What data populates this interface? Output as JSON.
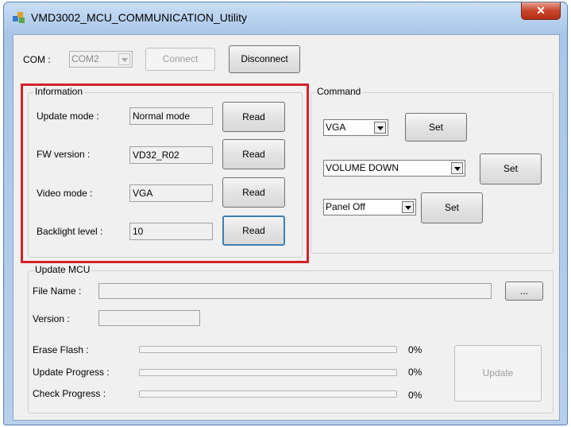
{
  "window": {
    "title": "VMD3002_MCU_COMMUNICATION_Utility",
    "close_glyph": "✕"
  },
  "com": {
    "label": "COM :",
    "port_value": "COM2",
    "connect_label": "Connect",
    "disconnect_label": "Disconnect"
  },
  "information": {
    "title": "Information",
    "rows": [
      {
        "label": "Update mode :",
        "value": "Normal mode",
        "button": "Read"
      },
      {
        "label": "FW version :",
        "value": "VD32_R02",
        "button": "Read"
      },
      {
        "label": "Video mode :",
        "value": "VGA",
        "button": "Read"
      },
      {
        "label": "Backlight level :",
        "value": "10",
        "button": "Read"
      }
    ]
  },
  "command": {
    "title": "Command",
    "rows": [
      {
        "value": "VGA",
        "button": "Set"
      },
      {
        "value": "VOLUME DOWN",
        "button": "Set"
      },
      {
        "value": "Panel Off",
        "button": "Set"
      }
    ]
  },
  "update_mcu": {
    "title": "Update MCU",
    "file_name_label": "File Name :",
    "file_name_value": "",
    "browse_label": "...",
    "version_label": "Version :",
    "version_value": "",
    "erase_label": "Erase Flash :",
    "erase_percent_text": "0%",
    "erase_progress": 0,
    "update_progress_label": "Update Progress :",
    "update_percent_text": "0%",
    "update_progress": 0,
    "check_label": "Check Progress :",
    "check_percent_text": "0%",
    "check_progress": 0,
    "update_button": "Update"
  },
  "colors": {
    "highlight": "#d2232a",
    "titlebar": "#a9c6e8",
    "close": "#c7442b"
  }
}
